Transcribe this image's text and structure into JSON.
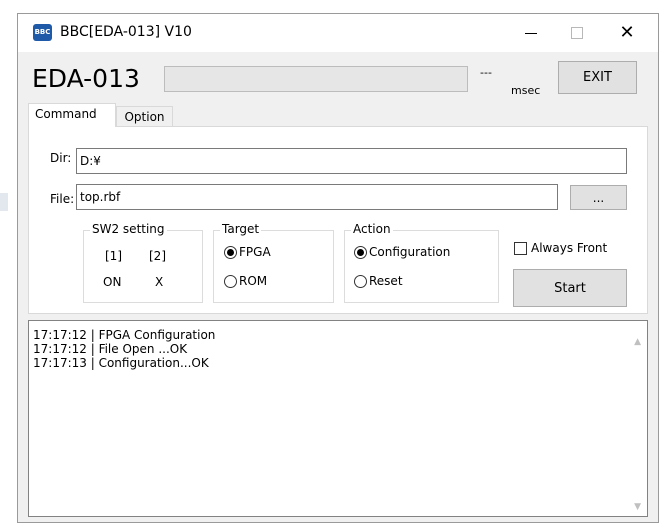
{
  "window": {
    "title": "BBC[EDA-013] V10",
    "icon_text": "BBC",
    "controls": {
      "minimize": "—",
      "maximize": "□",
      "close": "✕"
    }
  },
  "header": {
    "device_name": "EDA-013",
    "elapsed": "---",
    "unit": "msec",
    "exit_label": "EXIT",
    "progress": 0
  },
  "tabs": [
    {
      "label": "Command",
      "active": true
    },
    {
      "label": "Option",
      "active": false
    }
  ],
  "command": {
    "dir_label": "Dir:",
    "dir_value": "D:¥",
    "file_label": "File:",
    "file_value": "top.rbf",
    "browse_label": "..."
  },
  "sw2": {
    "title": "SW2 setting",
    "col1_header": "[1]",
    "col2_header": "[2]",
    "col1_value": "ON",
    "col2_value": "X"
  },
  "target": {
    "title": "Target",
    "options": [
      {
        "label": "FPGA",
        "selected": true
      },
      {
        "label": "ROM",
        "selected": false
      }
    ]
  },
  "action": {
    "title": "Action",
    "options": [
      {
        "label": "Configuration",
        "selected": true
      },
      {
        "label": "Reset",
        "selected": false
      }
    ]
  },
  "always_front": {
    "label": "Always Front",
    "checked": false
  },
  "start_label": "Start",
  "log": [
    "17:17:12 | FPGA Configuration",
    "17:17:12 | File Open ...OK",
    "17:17:13 | Configuration...OK"
  ],
  "icons": {
    "scroll_up": "up-arrow",
    "scroll_down": "down-arrow"
  }
}
